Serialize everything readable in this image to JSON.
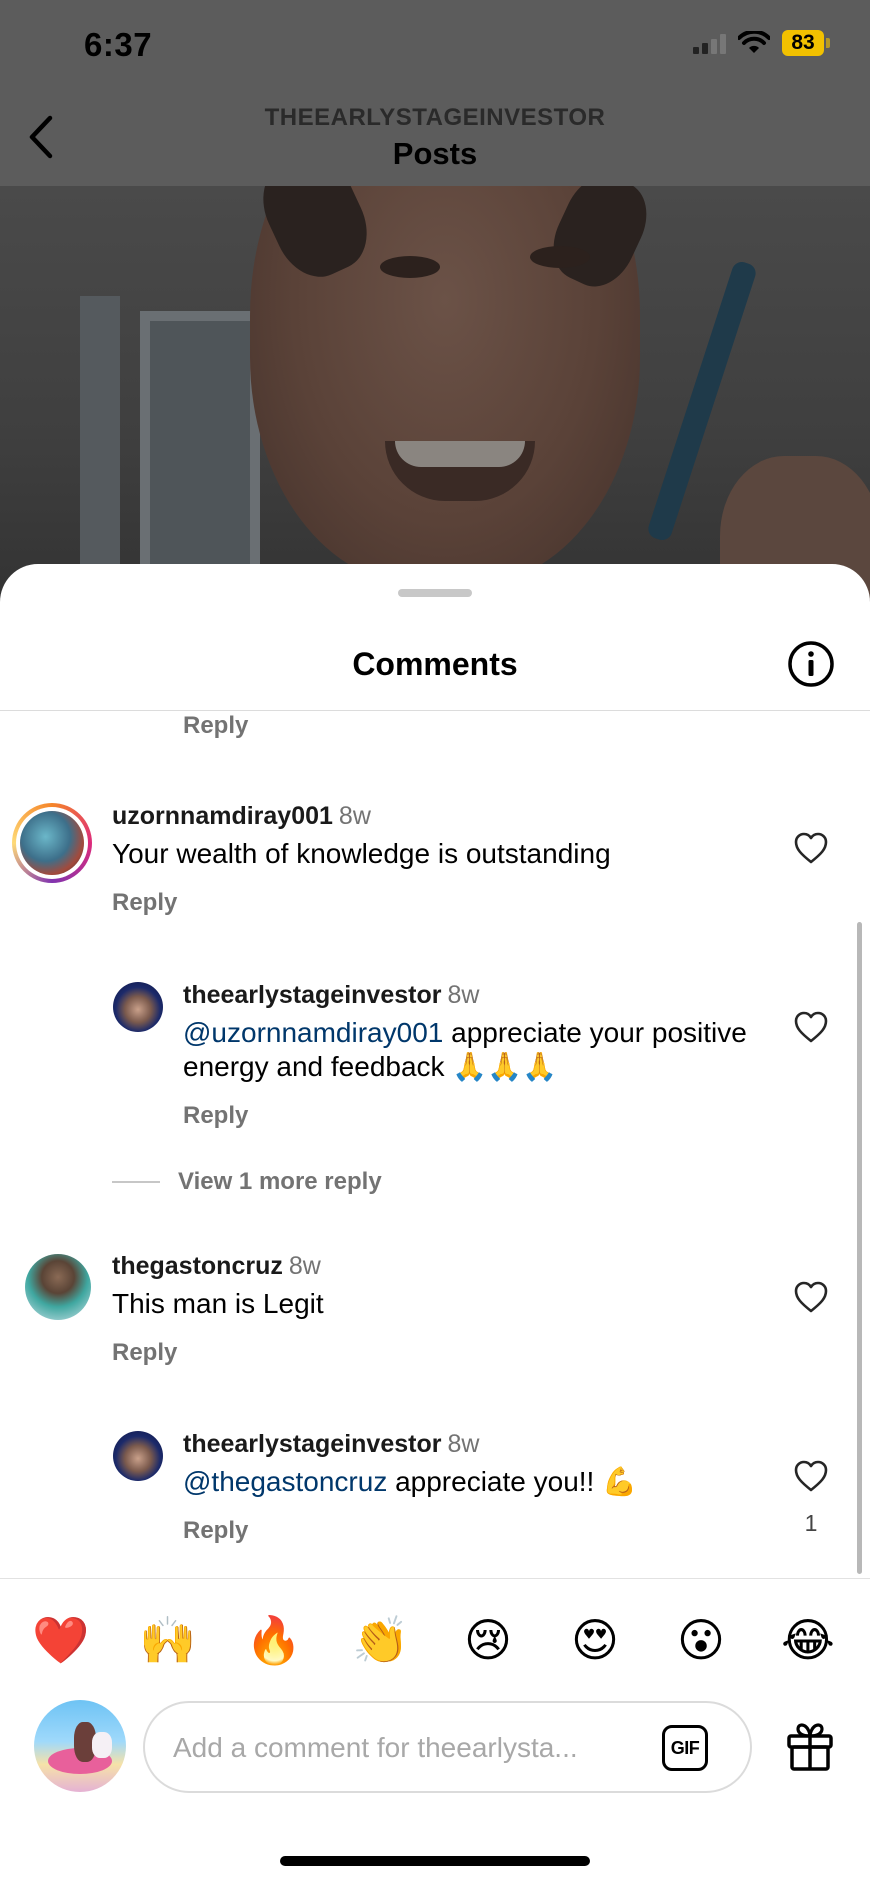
{
  "status_bar": {
    "time": "6:37",
    "battery": "83"
  },
  "header": {
    "account": "THEEARLYSTAGEINVESTOR",
    "title": "Posts"
  },
  "sheet": {
    "title": "Comments"
  },
  "comments": [
    {
      "kind": "reply_stub",
      "reply_label": "Reply"
    },
    {
      "username": "uzornnamdiray001",
      "time": "8w",
      "text": "Your wealth of knowledge is outstanding",
      "reply_label": "Reply"
    },
    {
      "username": "theearlystageinvestor",
      "time": "8w",
      "mention": "@uzornnamdiray001",
      "text": " appreciate your positive energy and feedback 🙏🙏🙏",
      "reply_label": "Reply"
    },
    {
      "username": "thegastoncruz",
      "time": "8w",
      "text": "This man is Legit",
      "reply_label": "Reply"
    },
    {
      "username": "theearlystageinvestor",
      "time": "8w",
      "mention": "@thegastoncruz",
      "text": " appreciate you!! 💪",
      "reply_label": "Reply",
      "likes": "1"
    }
  ],
  "view_more_replies": "View 1 more reply",
  "quick_emojis": [
    "❤️",
    "🙌",
    "🔥",
    "👏",
    "😢",
    "😍",
    "😮",
    "😂"
  ],
  "composer": {
    "placeholder": "Add a comment for theearlysta...",
    "gif_label": "GIF"
  },
  "colors": {
    "mention": "#00376b",
    "muted": "#737373",
    "battery": "#f2c100",
    "story_ring": "#e1306c"
  }
}
